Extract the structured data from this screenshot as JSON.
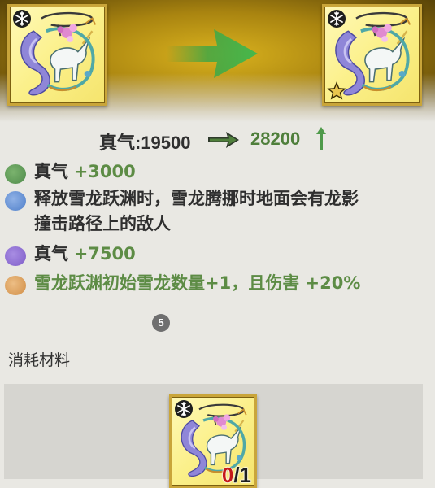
{
  "upgrade": {
    "from_item": {
      "icon": "dragon-unicorn-relic-icon",
      "corner_icon": "snowflake-icon"
    },
    "to_item": {
      "icon": "dragon-unicorn-relic-icon",
      "corner_icon": "snowflake-icon",
      "rank_icon": "star-icon"
    },
    "arrow_icon": "green-arrow-icon"
  },
  "stat": {
    "label": "真气:19500",
    "new_value": "28200"
  },
  "effects": [
    {
      "color": "#4e8a4a",
      "title": "真气",
      "value": "+3000"
    },
    {
      "color": "#4f7fc9",
      "line1": "释放雪龙跃渊时，雪龙腾挪时地面会有龙影",
      "line2": "撞击路径上的敌人"
    },
    {
      "color": "#7e5cc7",
      "title": "真气",
      "value": "+7500"
    },
    {
      "color": "#d89b55",
      "text": "雪龙跃渊初始雪龙数量+1，且伤害 +20%"
    }
  ],
  "badge": "5",
  "materials": {
    "title": "消耗材料",
    "items": [
      {
        "icon": "dragon-unicorn-relic-icon",
        "have": "0",
        "need": "/1"
      }
    ]
  }
}
